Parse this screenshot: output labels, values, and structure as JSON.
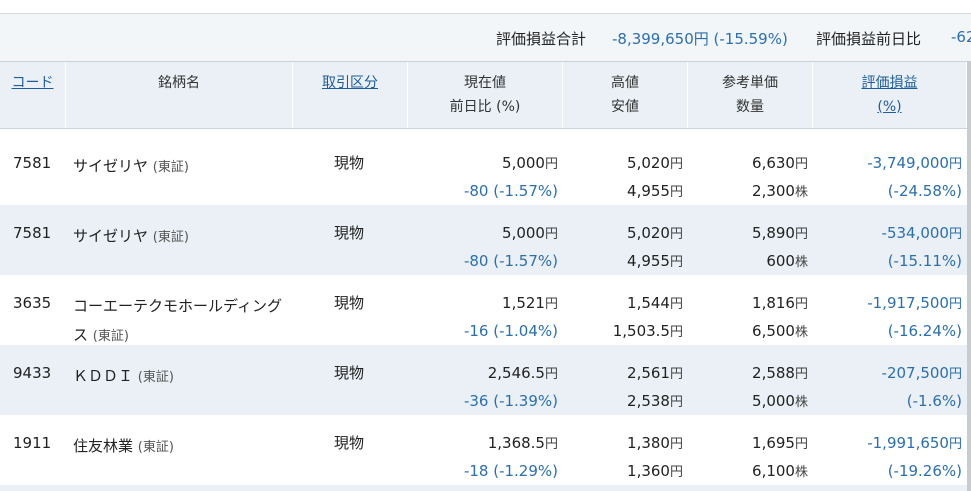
{
  "summary": {
    "total_label": "評価損益合計",
    "total_value": "-8,399,650円 (-15.59%)",
    "daychange_label": "評価損益前日比",
    "daychange_value": "-62"
  },
  "headers": {
    "code": "コード",
    "name": "銘柄名",
    "kind": "取引区分",
    "price_line1": "現在値",
    "price_line2": "前日比 (%)",
    "high": "高値",
    "low": "安値",
    "ref_price": "参考単価",
    "qty": "数量",
    "pl_line1": "評価損益",
    "pl_line2": "(%)"
  },
  "rows": [
    {
      "code": "7581",
      "name": "サイゼリヤ",
      "market": "(東証)",
      "kind": "現物",
      "price": "5,000",
      "change": "-80 (-1.57%)",
      "high": "5,020",
      "low": "4,955",
      "ref": "6,630",
      "qty": "2,300",
      "pl": "-3,749,000",
      "pl_pct": "(-24.58%)"
    },
    {
      "code": "7581",
      "name": "サイゼリヤ",
      "market": "(東証)",
      "kind": "現物",
      "price": "5,000",
      "change": "-80 (-1.57%)",
      "high": "5,020",
      "low": "4,955",
      "ref": "5,890",
      "qty": "600",
      "pl": "-534,000",
      "pl_pct": "(-15.11%)"
    },
    {
      "code": "3635",
      "name": "コーエーテクモホールディングス",
      "market": "(東証)",
      "kind": "現物",
      "price": "1,521",
      "change": "-16 (-1.04%)",
      "high": "1,544",
      "low": "1,503.5",
      "ref": "1,816",
      "qty": "6,500",
      "pl": "-1,917,500",
      "pl_pct": "(-16.24%)"
    },
    {
      "code": "9433",
      "name": "ＫＤＤＩ",
      "market": "(東証)",
      "kind": "現物",
      "price": "2,546.5",
      "change": "-36 (-1.39%)",
      "high": "2,561",
      "low": "2,538",
      "ref": "2,588",
      "qty": "5,000",
      "pl": "-207,500",
      "pl_pct": "(-1.6%)"
    },
    {
      "code": "1911",
      "name": "住友林業",
      "market": "(東証)",
      "kind": "現物",
      "price": "1,368.5",
      "change": "-18 (-1.29%)",
      "high": "1,380",
      "low": "1,360",
      "ref": "1,695",
      "qty": "6,100",
      "pl": "-1,991,650",
      "pl_pct": "(-19.26%)"
    }
  ],
  "units": {
    "yen": "円",
    "shares": "株"
  },
  "colors": {
    "accent": "#2a6fb0",
    "header_bg": "#eaf0f5",
    "stripe_bg": "#eaf0f5"
  }
}
